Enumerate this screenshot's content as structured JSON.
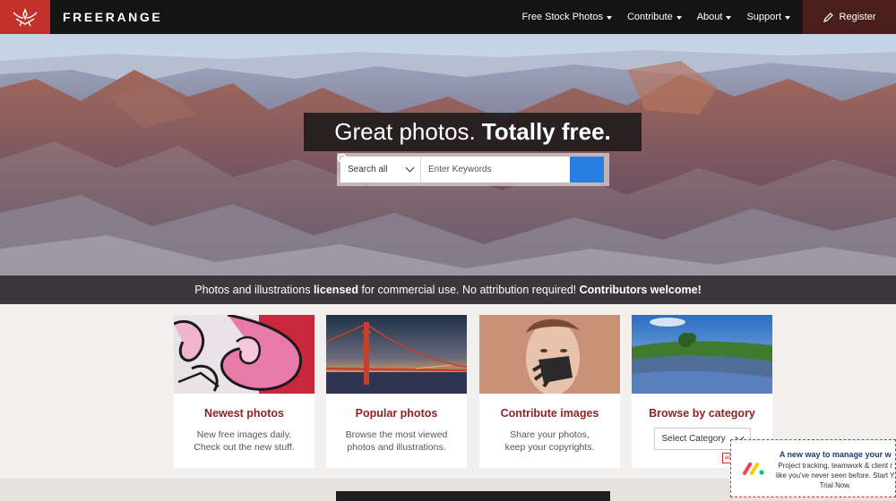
{
  "brand": {
    "name": "FREERANGE"
  },
  "nav": {
    "items": [
      {
        "label": "Free Stock Photos"
      },
      {
        "label": "Contribute"
      },
      {
        "label": "About"
      },
      {
        "label": "Support"
      }
    ],
    "register_label": "Register"
  },
  "hero": {
    "headline_regular": "Great photos.",
    "headline_bold": "Totally free.",
    "search": {
      "scope_label": "Search all",
      "placeholder": "Enter Keywords"
    },
    "tagline": {
      "part1": "Photos and illustrations ",
      "bold1": "licensed",
      "part2": " for commercial use. No attribution required! ",
      "bold2": "Contributors welcome!"
    }
  },
  "cards": [
    {
      "title": "Newest photos",
      "desc1": "New free images daily.",
      "desc2": "Check out the new stuff."
    },
    {
      "title": "Popular photos",
      "desc1": "Browse the most viewed",
      "desc2": "photos and illustrations."
    },
    {
      "title": "Contribute images",
      "desc1": "Share your photos,",
      "desc2": "keep your copyrights."
    },
    {
      "title": "Browse by category",
      "select_label": "Select Category"
    }
  ],
  "ad": {
    "title": "A new way to manage your w",
    "line1": "Project tracking, teamwork & client r",
    "line2": "like you've never seen before. Start Y",
    "line3": "Trial Now.",
    "badge": "ad"
  },
  "colors": {
    "accent_red": "#c3312b",
    "title_red": "#8e2421",
    "search_blue": "#2a7de1"
  }
}
